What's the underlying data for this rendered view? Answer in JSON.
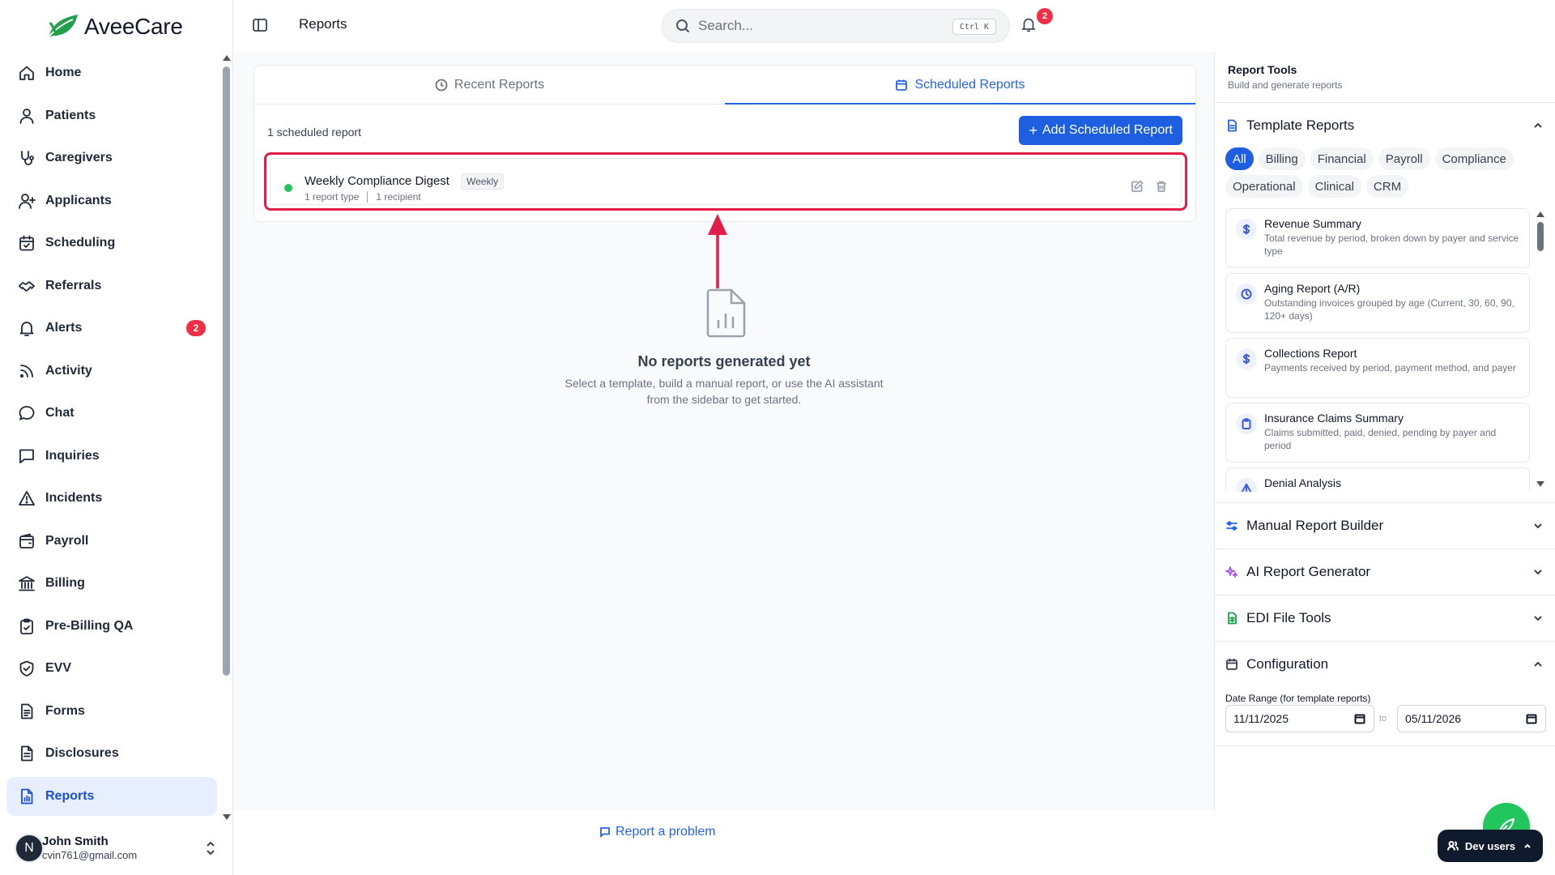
{
  "brand": {
    "name": "AveeCare",
    "leaf_color": "#22a04b"
  },
  "sidebar": {
    "items": [
      {
        "label": "Home",
        "icon": "home-icon"
      },
      {
        "label": "Patients",
        "icon": "user-icon"
      },
      {
        "label": "Caregivers",
        "icon": "stethoscope-icon"
      },
      {
        "label": "Applicants",
        "icon": "user-plus-icon"
      },
      {
        "label": "Scheduling",
        "icon": "calendar-icon"
      },
      {
        "label": "Referrals",
        "icon": "handshake-icon"
      },
      {
        "label": "Alerts",
        "icon": "bell-icon",
        "badge": "2"
      },
      {
        "label": "Activity",
        "icon": "rss-icon"
      },
      {
        "label": "Chat",
        "icon": "chat-bubble-icon"
      },
      {
        "label": "Inquiries",
        "icon": "message-square-icon"
      },
      {
        "label": "Incidents",
        "icon": "warning-triangle-icon"
      },
      {
        "label": "Payroll",
        "icon": "wallet-icon"
      },
      {
        "label": "Billing",
        "icon": "bank-icon"
      },
      {
        "label": "Pre-Billing QA",
        "icon": "clipboard-check-icon"
      },
      {
        "label": "EVV",
        "icon": "shield-check-icon"
      },
      {
        "label": "Forms",
        "icon": "file-list-icon"
      },
      {
        "label": "Disclosures",
        "icon": "file-text-icon"
      },
      {
        "label": "Reports",
        "icon": "file-chart-icon",
        "active": true
      }
    ],
    "user": {
      "initial": "N",
      "name": "John Smith",
      "email": "cvin761@gmail.com"
    }
  },
  "header": {
    "title": "Reports",
    "search_placeholder": "Search...",
    "search_shortcut": "Ctrl K",
    "notification_count": "2"
  },
  "main": {
    "tabs": [
      {
        "label": "Recent Reports",
        "icon": "clock-icon",
        "active": false
      },
      {
        "label": "Scheduled Reports",
        "icon": "calendar-icon",
        "active": true
      }
    ],
    "scheduled_count_text": "1 scheduled report",
    "add_button_label": "Add Scheduled Report",
    "scheduled_items": [
      {
        "title": "Weekly Compliance Digest",
        "frequency": "Weekly",
        "report_types": "1 report type",
        "recipients": "1 recipient",
        "status_color": "#22c55e"
      }
    ],
    "highlight_color": "#e11d48",
    "empty_state": {
      "title": "No reports generated yet",
      "description": "Select a template, build a manual report, or use the AI assistant from the sidebar to get started."
    },
    "report_problem_label": "Report a problem"
  },
  "right_panel": {
    "title": "Report Tools",
    "subtitle": "Build and generate reports",
    "template_section_title": "Template Reports",
    "filters": [
      "All",
      "Billing",
      "Financial",
      "Payroll",
      "Compliance",
      "Operational",
      "Clinical",
      "CRM"
    ],
    "active_filter": "All",
    "templates": [
      {
        "name": "Revenue Summary",
        "description": "Total revenue by period, broken down by payer and service type",
        "icon": "dollar-icon"
      },
      {
        "name": "Aging Report (A/R)",
        "description": "Outstanding invoices grouped by age (Current, 30, 60, 90, 120+ days)",
        "icon": "clock-icon"
      },
      {
        "name": "Collections Report",
        "description": "Payments received by period, payment method, and payer",
        "icon": "dollar-icon"
      },
      {
        "name": "Insurance Claims Summary",
        "description": "Claims submitted, paid, denied, pending by payer and period",
        "icon": "clipboard-icon"
      },
      {
        "name": "Denial Analysis",
        "description": "",
        "icon": "warning-triangle-icon"
      }
    ],
    "sections": {
      "manual": "Manual Report Builder",
      "ai": "AI Report Generator",
      "edi": "EDI File Tools",
      "config": "Configuration"
    },
    "config": {
      "date_range_label": "Date Range (for template reports)",
      "from": "11/11/2025",
      "to_label": "to",
      "to": "05/11/2026"
    }
  },
  "floating": {
    "dev_users_label": "Dev users"
  }
}
